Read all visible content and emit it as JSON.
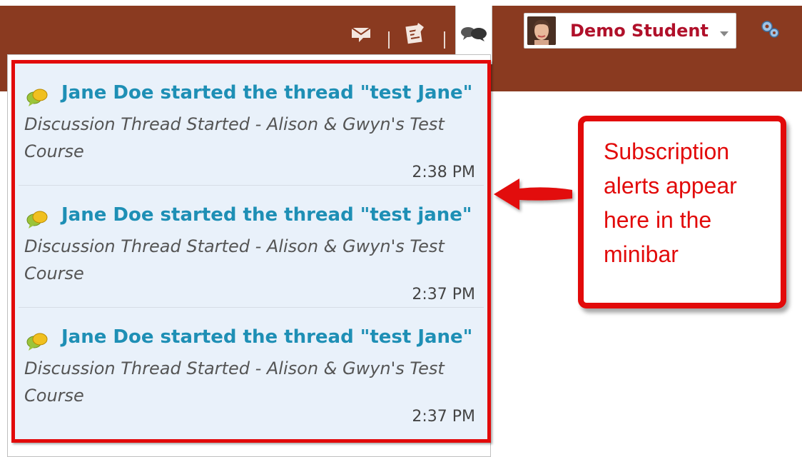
{
  "minibar": {
    "icons": [
      "message-alerts-icon",
      "update-alerts-icon",
      "subscription-alerts-icon"
    ],
    "user": {
      "name": "Demo Student"
    },
    "settings_icon": "gear-icon",
    "colors": {
      "bar": "#8a3a20",
      "user_name": "#b0102a"
    }
  },
  "alerts": [
    {
      "title": "Jane Doe started the thread \"test Jane\"",
      "description": "Discussion Thread Started - Alison & Gwyn's Test Course",
      "time": "2:38 PM"
    },
    {
      "title": "Jane Doe started the thread \"test jane\"",
      "description": "Discussion Thread Started - Alison & Gwyn's Test Course",
      "time": "2:37 PM"
    },
    {
      "title": "Jane Doe started the thread \"test Jane\"",
      "description": "Discussion Thread Started - Alison & Gwyn's Test Course",
      "time": "2:37 PM"
    }
  ],
  "callout": {
    "text": "Subscription alerts appear here in the minibar",
    "color": "#e20a0a"
  }
}
